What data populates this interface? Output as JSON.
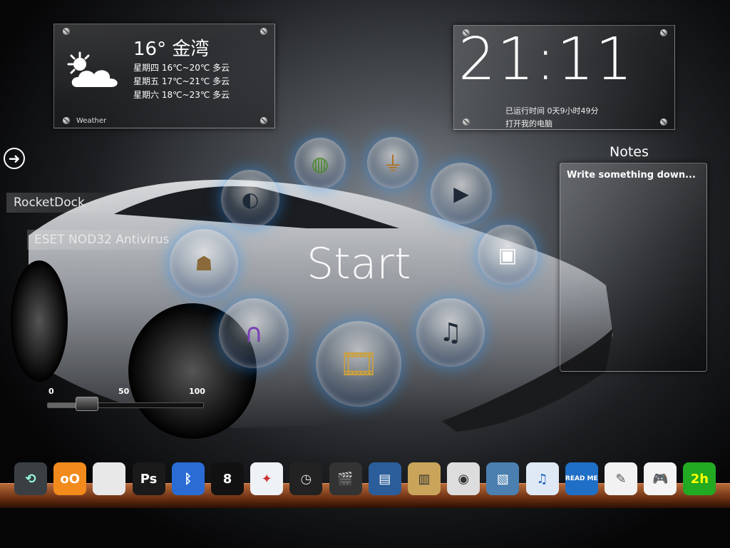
{
  "weather": {
    "temp_city": "16° 金湾",
    "forecast": [
      "星期四 16℃~20℃ 多云",
      "星期五 17℃~21℃ 多云",
      "星期六 18℃~23℃ 多云"
    ],
    "label": "Weather"
  },
  "clock": {
    "time": "21:11",
    "uptime": "已运行时间 0天9小时49分",
    "open_computer": "打开我的电脑"
  },
  "sidebar": {
    "arrow_glyph": "➜",
    "items": [
      "RocketDock",
      "ESET NOD32 Antivirus"
    ]
  },
  "notes": {
    "title": "Notes",
    "placeholder": "Write something down..."
  },
  "start": {
    "label": "Start",
    "ring_icons": [
      "browser-icon",
      "globe-icon",
      "lamp-icon",
      "play-icon",
      "folder-icon",
      "itunes-icon",
      "film-icon",
      "headphones-icon",
      "gadget-icon"
    ]
  },
  "volume": {
    "ticks": [
      "0",
      "50",
      "100"
    ],
    "level_percent": 25
  },
  "dock": {
    "icons": [
      {
        "name": "time-machine-icon",
        "glyph": "⟲",
        "bg": "#3a3f44",
        "fg": "#9fd"
      },
      {
        "name": "messenger-icon",
        "glyph": "oO",
        "bg": "#f28a1c",
        "fg": "#fff"
      },
      {
        "name": "mac-mini-icon",
        "glyph": "",
        "bg": "#e8e8e8",
        "fg": "#888"
      },
      {
        "name": "photoshop-icon",
        "glyph": "Ps",
        "bg": "#1a1a1a",
        "fg": "#fff"
      },
      {
        "name": "bluetooth-icon",
        "glyph": "ᛒ",
        "bg": "#2a6cd4",
        "fg": "#fff"
      },
      {
        "name": "eight-ball-icon",
        "glyph": "8",
        "bg": "#111",
        "fg": "#fff"
      },
      {
        "name": "safari-icon",
        "glyph": "✦",
        "bg": "#eef2f6",
        "fg": "#c33"
      },
      {
        "name": "dashboard-icon",
        "glyph": "◷",
        "bg": "#222",
        "fg": "#ddd"
      },
      {
        "name": "clapperboard-icon",
        "glyph": "🎬",
        "bg": "#333",
        "fg": "#fff"
      },
      {
        "name": "video-editor-icon",
        "glyph": "▤",
        "bg": "#2b5d9a",
        "fg": "#fff"
      },
      {
        "name": "books-icon",
        "glyph": "▥",
        "bg": "#c9a45a",
        "fg": "#333"
      },
      {
        "name": "photo-booth-icon",
        "glyph": "◉",
        "bg": "#ddd",
        "fg": "#333"
      },
      {
        "name": "iphoto-icon",
        "glyph": "▧",
        "bg": "#4a7fb0",
        "fg": "#fff"
      },
      {
        "name": "itunes-icon",
        "glyph": "♫",
        "bg": "#dfe9f5",
        "fg": "#1c5fb8"
      },
      {
        "name": "ebook-icon",
        "glyph": "READ ME",
        "bg": "#1f6fc6",
        "fg": "#fff"
      },
      {
        "name": "textedit-icon",
        "glyph": "✎",
        "bg": "#f2f2f2",
        "fg": "#555"
      },
      {
        "name": "gamepad-icon",
        "glyph": "🎮",
        "bg": "#f4f4f4",
        "fg": "#333"
      },
      {
        "name": "app-25-icon",
        "glyph": "2h",
        "bg": "#2a2",
        "fg": "#ff0"
      }
    ]
  }
}
